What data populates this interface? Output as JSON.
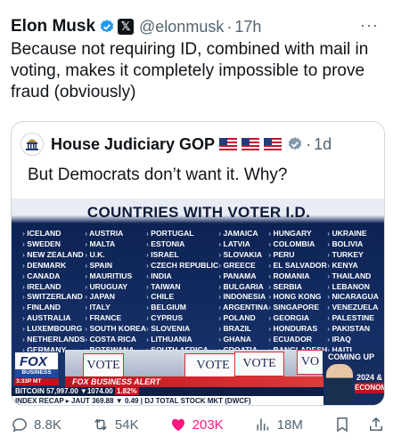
{
  "post": {
    "author_name": "Elon Musk",
    "handle": "@elonmusk",
    "separator": "·",
    "time": "17h",
    "more": "···",
    "text": "Because not requiring ID, combined with mail in voting, makes it completely impossible to prove fraud (obviously)"
  },
  "quote": {
    "author_name": "House Judiciary GOP",
    "separator": "·",
    "time": "1d",
    "text": "But Democrats don’t want it. Why?"
  },
  "media": {
    "title": "COUNTRIES WITH VOTER I.D.",
    "columns": [
      [
        "ICELAND",
        "SWEDEN",
        "NEW ZEALAND",
        "DENMARK",
        "CANADA",
        "IRELAND",
        "SWITZERLAND",
        "FINLAND",
        "AUSTRALIA",
        "LUXEMBOURG",
        "NETHERLANDS",
        "GERMANY"
      ],
      [
        "AUSTRIA",
        "MALTA",
        "U.K.",
        "SPAIN",
        "MAURITIUS",
        "URUGUAY",
        "JAPAN",
        "ITALY",
        "FRANCE",
        "SOUTH KOREA",
        "COSTA RICA",
        "BOTSWANA"
      ],
      [
        "PORTUGAL",
        "ESTONIA",
        "ISRAEL",
        "CZECH REPUBLIC",
        "INDIA",
        "TAIWAN",
        "CHILE",
        "BELGIUM",
        "CYPRUS",
        "SLOVENIA",
        "LITHUANIA",
        "SOUTH AFRICA"
      ],
      [
        "JAMAICA",
        "LATVIA",
        "SLOVAKIA",
        "GREECE",
        "PANAMA",
        "BULGARIA",
        "INDONESIA",
        "ARGENTINA",
        "POLAND",
        "BRAZIL",
        "GHANA",
        "CROATIA"
      ],
      [
        "HUNGARY",
        "COLOMBIA",
        "PERU",
        "EL SALVADOR",
        "ROMANIA",
        "SERBIA",
        "HONG KONG",
        "SINGAPORE",
        "GEORGIA",
        "HONDURAS",
        "ECUADOR",
        "BANGLADESH"
      ],
      [
        "UKRAINE",
        "BOLIVIA",
        "TURKEY",
        "KENYA",
        "THAILAND",
        "LEBANON",
        "NICARAGUA",
        "VENEZUELA",
        "PALESTINE",
        "PAKISTAN",
        "IRAQ",
        "HAITI"
      ]
    ],
    "network_logo": "FOX",
    "network_sub": "BUSINESS",
    "vote_1": "VOTE",
    "vote_2": "VOTE",
    "vote_3": "VO",
    "coming_up": "COMING UP",
    "year": "2024 &",
    "economy": "ECONOMY",
    "clock": "3:33P MT",
    "alert": "FOX BUSINESS ALERT",
    "ticker_line": "BITCOIN 57,997.00 ▼1074.00",
    "ticker_pct": "1.82%",
    "ticker_line2": "INDEX RECAP ▸ JAUT 369.88 ▼ 0.49 | DJ TOTAL STOCK MKT (DWCF)"
  },
  "actions": {
    "replies": "8.8K",
    "reposts": "54K",
    "likes": "203K",
    "views": "18M"
  },
  "colors": {
    "verified_blue": "#1d9bf0",
    "like_pink": "#f91880",
    "muted": "#536471"
  }
}
